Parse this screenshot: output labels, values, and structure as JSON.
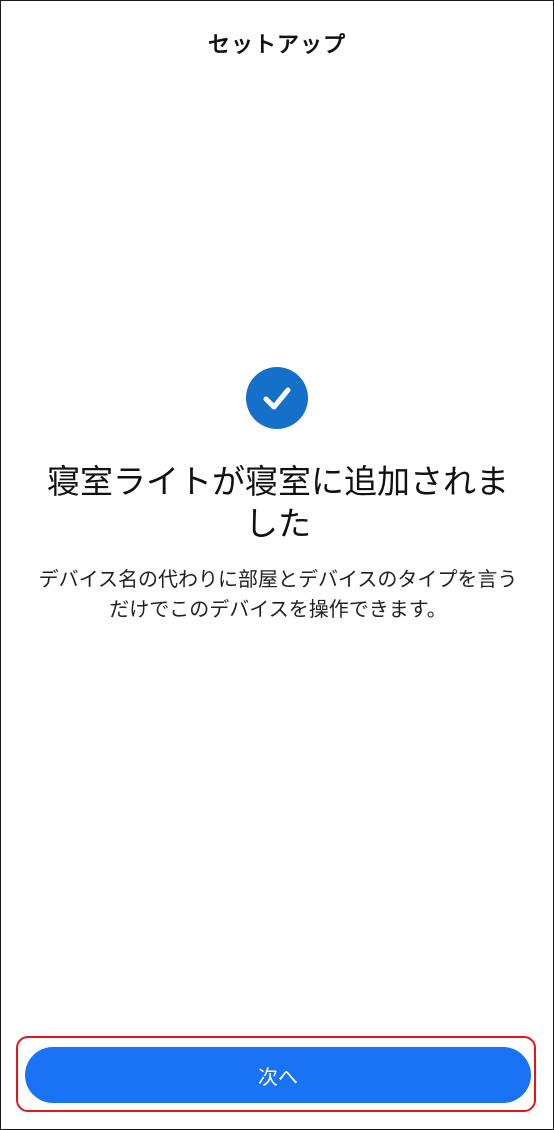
{
  "header": {
    "title": "セットアップ"
  },
  "success": {
    "icon": "check-circle-icon",
    "title": "寝室ライトが寝室に追加されました",
    "description": "デバイス名の代わりに部屋とデバイスのタイプを言うだけでこのデバイスを操作できます。"
  },
  "actions": {
    "next_label": "次へ"
  },
  "colors": {
    "accent": "#1a73f5",
    "check_circle": "#1470c9",
    "highlight_border": "#e8141c"
  }
}
